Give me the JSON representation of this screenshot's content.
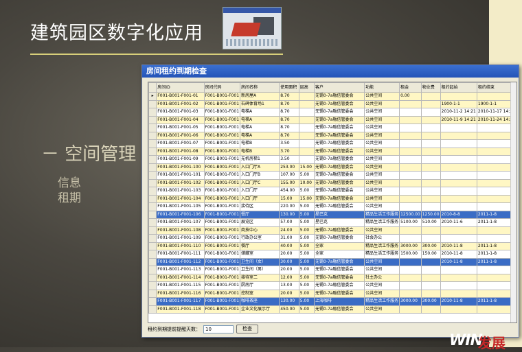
{
  "slide": {
    "title": "建筑园区数字化应用",
    "section": "－ 空间管理",
    "sub_items": [
      "信息",
      "租期"
    ],
    "logo_text": "WIN",
    "logo_mark": "发展"
  },
  "window": {
    "title": "房间租约到期检查",
    "bottom_label": "租约到期提前提醒天数：",
    "days_value": "10",
    "confirm_button": "检查"
  },
  "table": {
    "headers": [
      "房间ID",
      "房间代码",
      "房间名称",
      "使用面积",
      "层高",
      "客户",
      "功能",
      "租金",
      "物业费",
      "租约起始",
      "租约结束"
    ],
    "rows": [
      {
        "style": "yel",
        "cells": [
          "F001-B001-F001-01",
          "F001-B001-F001",
          "新房屋A",
          "8.70",
          "",
          "无锡0-7a融信管委会",
          "公共空间",
          "0.00",
          "",
          "",
          ""
        ]
      },
      {
        "style": "yel",
        "cells": [
          "F001-B001-F001-02",
          "F001-B001-F001",
          "石碑体育场1",
          "8.70",
          "",
          "无锡0-7a融信管委会",
          "公共空间",
          "",
          "",
          "1900-1-1",
          "1900-1-1"
        ]
      },
      {
        "style": "wht",
        "cells": [
          "F001-B001-F001-03",
          "F001-B001-F001",
          "电梯A",
          "8.70",
          "",
          "无锡0-7a融信管委会",
          "公共空间",
          "",
          "",
          "2010-11-2 14:21",
          "2010-11-17 14:25"
        ]
      },
      {
        "style": "yel",
        "cells": [
          "F001-B001-F001-04",
          "F001-B001-F001",
          "电梯A",
          "8.70",
          "",
          "无锡0-7a融信管委会",
          "公共空间",
          "",
          "",
          "2010-11-9 14:21",
          "2010-11-24 14:25"
        ]
      },
      {
        "style": "wht",
        "cells": [
          "F001-B001-F001-05",
          "F001-B001-F001",
          "电梯A",
          "8.70",
          "",
          "无锡0-7a融信管委会",
          "公共空间",
          "",
          "",
          "",
          ""
        ]
      },
      {
        "style": "yel",
        "cells": [
          "F001-B001-F001-06",
          "F001-B001-F001",
          "电梯A",
          "8.70",
          "",
          "无锡0-7a融信管委会",
          "公共空间",
          "",
          "",
          "",
          ""
        ]
      },
      {
        "style": "wht",
        "cells": [
          "F001-B001-F001-07",
          "F001-B001-F001",
          "电梯B",
          "3.50",
          "",
          "无锡0-7a融信管委会",
          "公共空间",
          "",
          "",
          "",
          ""
        ]
      },
      {
        "style": "yel",
        "cells": [
          "F001-B001-F001-08",
          "F001-B001-F001",
          "电梯B",
          "3.70",
          "",
          "无锡0-7a融信管委会",
          "公共空间",
          "",
          "",
          "",
          ""
        ]
      },
      {
        "style": "wht",
        "cells": [
          "F001-B001-F001-09",
          "F001-B001-F001",
          "无机房梯1",
          "3.50",
          "",
          "无锡0-7a融信管委会",
          "公共空间",
          "",
          "",
          "",
          ""
        ]
      },
      {
        "style": "yel",
        "cells": [
          "F001-B001-F001-100",
          "F001-B001-F001",
          "入口门厅A",
          "253.00",
          "15.00",
          "无锡0-7a融信管委会",
          "公共空间",
          "",
          "",
          "",
          ""
        ]
      },
      {
        "style": "wht",
        "cells": [
          "F001-B001-F001-101",
          "F001-B001-F001",
          "入口门厅B",
          "107.00",
          "5.00",
          "无锡0-7a融信管委会",
          "公共空间",
          "",
          "",
          "",
          ""
        ]
      },
      {
        "style": "yel",
        "cells": [
          "F001-B001-F001-102",
          "F001-B001-F001",
          "入口门厅C",
          "155.00",
          "10.00",
          "无锡0-7a融信管委会",
          "公共空间",
          "",
          "",
          "",
          ""
        ]
      },
      {
        "style": "wht",
        "cells": [
          "F001-B001-F001-103",
          "F001-B001-F001",
          "入口门厅",
          "454.00",
          "5.00",
          "无锡0-7a融信管委会",
          "公共空间",
          "",
          "",
          "",
          ""
        ]
      },
      {
        "style": "yel",
        "cells": [
          "F001-B001-F001-104",
          "F001-B001-F001",
          "入口门厅",
          "15.00",
          "15.00",
          "无锡0-7a融信管委会",
          "公共空间",
          "",
          "",
          "",
          ""
        ]
      },
      {
        "style": "wht",
        "cells": [
          "F001-B001-F001-105",
          "F001-B001-F001",
          "接待区",
          "220.00",
          "5.00",
          "无锡0-7a融信管委会",
          "公共空间",
          "",
          "",
          "",
          ""
        ]
      },
      {
        "style": "sel",
        "cells": [
          "F001-B001-F001-106",
          "F001-B001-F001",
          "餐厅",
          "130.00",
          "5.00",
          "星巴克",
          "精品生活工作服务",
          "12500.00",
          "1250.00",
          "2010-8-8",
          "2011-1-8"
        ]
      },
      {
        "style": "wht",
        "cells": [
          "F001-B001-F001-107",
          "F001-B001-F001",
          "展览区",
          "57.00",
          "5.00",
          "星巴克",
          "精品生活工作服务",
          "5100.00",
          "510.00",
          "2010-11-6",
          "2011-1-8"
        ]
      },
      {
        "style": "yel",
        "cells": [
          "F001-B001-F001-108",
          "F001-B001-F001",
          "商技中心",
          "24.00",
          "5.00",
          "无锡0-7a融信管委会",
          "公共空间",
          "",
          "",
          "",
          ""
        ]
      },
      {
        "style": "wht",
        "cells": [
          "F001-B001-F001-109",
          "F001-B001-F001",
          "行政办公室",
          "31.00",
          "5.00",
          "无锡0-7a融信管委会",
          "社会办公",
          "",
          "",
          "",
          ""
        ]
      },
      {
        "style": "yel",
        "cells": [
          "F001-B001-F001-110",
          "F001-B001-F001",
          "餐厅",
          "40.00",
          "5.00",
          "全家",
          "精品生活工作服务",
          "3000.00",
          "300.00",
          "2010-11-8",
          "2011-1-8"
        ]
      },
      {
        "style": "wht",
        "cells": [
          "F001-B001-F001-111",
          "F001-B001-F001",
          "储藏室",
          "20.00",
          "5.00",
          "全家",
          "精品生活工作服务",
          "1500.00",
          "150.00",
          "2010-11-8",
          "2011-1-8"
        ]
      },
      {
        "style": "sel",
        "cells": [
          "F001-B001-F001-112",
          "F001-B001-F001",
          "卫生间（女）",
          "30.00",
          "5.00",
          "无锡0-7a融信管委会",
          "公共空间",
          "",
          "",
          "2010-11-8",
          "2011-1-8"
        ]
      },
      {
        "style": "wht",
        "cells": [
          "F001-B001-F001-113",
          "F001-B001-F001",
          "卫生间（男）",
          "20.00",
          "5.00",
          "无锡0-7a融信管委会",
          "公共空间",
          "",
          "",
          "",
          ""
        ]
      },
      {
        "style": "yel",
        "cells": [
          "F001-B001-F001-114",
          "F001-B001-F001",
          "接待室二",
          "12.00",
          "5.00",
          "无锡0-7a融信管委会",
          "社主办公",
          "",
          "",
          "",
          ""
        ]
      },
      {
        "style": "wht",
        "cells": [
          "F001-B001-F001-115",
          "F001-B001-F001",
          "厨房厅",
          "13.00",
          "5.00",
          "无锡0-7a融信管委会",
          "公共空间",
          "",
          "",
          "",
          ""
        ]
      },
      {
        "style": "yel",
        "cells": [
          "F001-B001-F001-116",
          "F001-B001-F001",
          "控制室",
          "20.00",
          "5.00",
          "无锡0-7a融信管委会",
          "公共空间",
          "",
          "",
          "",
          ""
        ]
      },
      {
        "style": "sel",
        "cells": [
          "F001-B001-F001-117",
          "F001-B001-F001",
          "咖啡茶座",
          "130.00",
          "5.00",
          "上海咖啡",
          "精品生活工作服务",
          "3000.00",
          "300.00",
          "2010-11-8",
          "2011-1-8"
        ]
      },
      {
        "style": "yel",
        "cells": [
          "F001-B001-F001-118",
          "F001-B001-F001",
          "企业文化展示厅",
          "450.00",
          "5.00",
          "无锡0-7a融信管委会",
          "公共空间",
          "",
          "",
          "",
          ""
        ]
      }
    ]
  },
  "colors": {
    "selected_row": "#3a6cc5",
    "alt_row": "#fff7c4",
    "title_bar": "#2454b8"
  }
}
